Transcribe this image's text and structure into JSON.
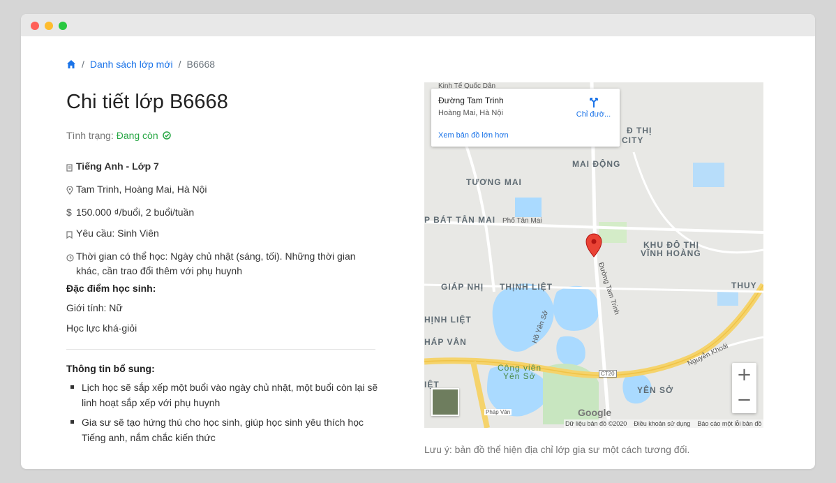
{
  "breadcrumb": {
    "home_icon": "home-icon",
    "link": "Danh sách lớp mới",
    "current": "B6668"
  },
  "title": "Chi tiết lớp B6668",
  "status": {
    "label": "Tình trạng:",
    "value": "Đang còn",
    "color": "#28a745"
  },
  "info": {
    "subject": "Tiếng Anh - Lớp 7",
    "location": "Tam Trinh, Hoàng Mai, Hà Nội",
    "fee": "150.000 ₫/buổi, 2 buổi/tuần",
    "requirement": "Yêu cầu: Sinh Viên",
    "time": "Thời gian có thể học: Ngày chủ nhật (sáng, tối). Những thời gian khác, cần trao đổi thêm với phụ huynh"
  },
  "student": {
    "heading": "Đặc điểm học sinh:",
    "gender": "Giới tính: Nữ",
    "level": "Học lực khá-giỏi"
  },
  "extra": {
    "heading": "Thông tin bổ sung:",
    "items": [
      "Lịch học sẽ sắp xếp một buổi vào ngày chủ nhật, một buổi còn lại sẽ linh hoạt sắp xếp với phụ huynh",
      "Gia sư sẽ tạo hứng thú cho học sinh, giúp học sinh yêu thích học Tiếng anh, nắm chắc kiến thức"
    ]
  },
  "map": {
    "place_name": "Đường Tam Trinh",
    "place_addr": "Hoàng Mai, Hà Nội",
    "bigger_link": "Xem bản đồ lớn hơn",
    "directions": "Chỉ đườ...",
    "labels": {
      "kinh_te": "Kinh Tế Quốc Dân",
      "do_thi": "Đ THỊ",
      "city": "CITY",
      "mai_dong": "MAI ĐỘNG",
      "tuong_mai": "TƯƠNG MAI",
      "bat_tan_mai": "P BÁT TÂN MAI",
      "pho_tan_mai": "Phố Tân Mai",
      "kdt1": "KHU ĐÔ THỊ",
      "kdt2": "VĨNH HOÀNG",
      "giap_nhi": "GIÁP NHỊ",
      "thinh_liet": "THỊNH LIỆT",
      "thuy": "THUY",
      "ho_yen_so": "Hồ Yên Sở",
      "duong_tam_trinh": "Đường Tam Trinh",
      "inh_liet": "HỊNH LIỆT",
      "hap_van": "HÁP VÂN",
      "cong_vien": "Công viên",
      "yen_so_park": "Yên Sở",
      "yen_so": "YÊN SỞ",
      "ct20": "CT20",
      "nguyen_khoai": "Nguyễn Khoái",
      "phap_van": "Pháp Vân",
      "iet": "IỆT"
    },
    "google": "Google",
    "footer": [
      "Dữ liệu bản đồ ©2020",
      "Điều khoản sử dụng",
      "Báo cáo một lỗi bản đồ"
    ],
    "zoom_in": "+",
    "zoom_out": "−"
  },
  "note": "Lưu ý: bản đồ thể hiện địa chỉ lớp gia sư một cách tương đối."
}
